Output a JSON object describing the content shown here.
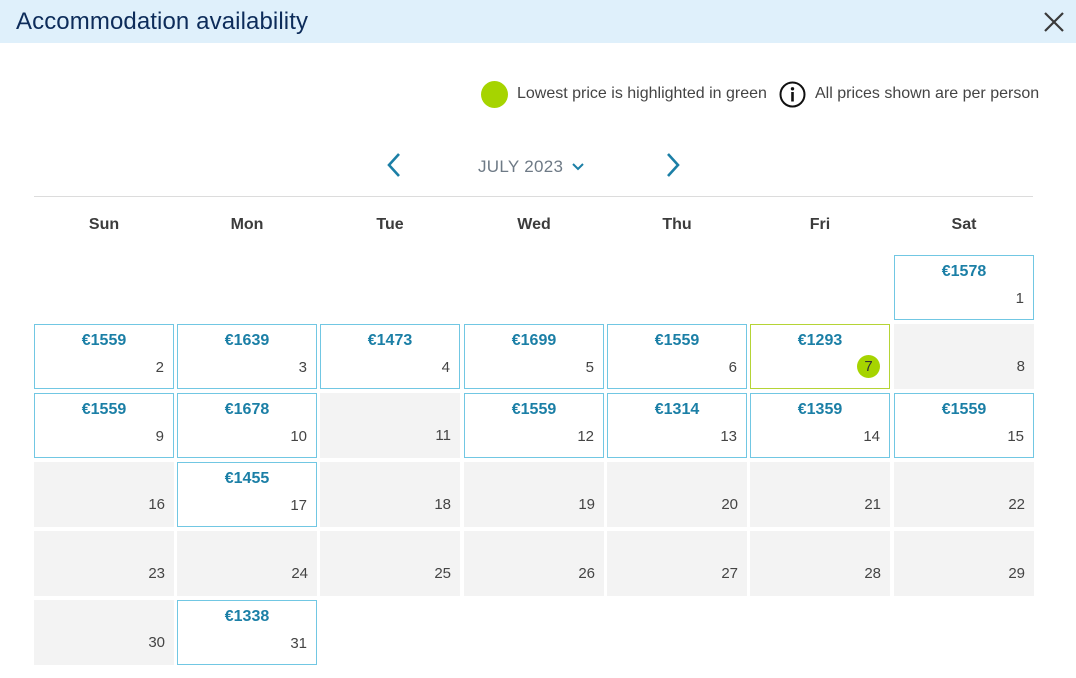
{
  "dialog": {
    "title": "Accommodation availability",
    "close_icon": "close-icon"
  },
  "legend": {
    "lowest_text": "Lowest price is highlighted in green",
    "info_text": "All prices shown are per person",
    "info_icon": "info-icon"
  },
  "colors": {
    "accent_blue": "#1b7fa6",
    "lowest_green": "#a6d400",
    "available_border": "#71c7e3",
    "unavailable_bg": "#f3f3f3",
    "header_bg": "#dff0fb"
  },
  "calendar": {
    "month_label": "JULY 2023",
    "weekdays": [
      "Sun",
      "Mon",
      "Tue",
      "Wed",
      "Thu",
      "Fri",
      "Sat"
    ],
    "days": [
      {
        "day": "1",
        "price": "€1578"
      },
      {
        "day": "2",
        "price": "€1559"
      },
      {
        "day": "3",
        "price": "€1639"
      },
      {
        "day": "4",
        "price": "€1473"
      },
      {
        "day": "5",
        "price": "€1699"
      },
      {
        "day": "6",
        "price": "€1559"
      },
      {
        "day": "7",
        "price": "€1293",
        "lowest": true
      },
      {
        "day": "8",
        "price": ""
      },
      {
        "day": "9",
        "price": "€1559"
      },
      {
        "day": "10",
        "price": "€1678"
      },
      {
        "day": "11",
        "price": ""
      },
      {
        "day": "12",
        "price": "€1559"
      },
      {
        "day": "13",
        "price": "€1314"
      },
      {
        "day": "14",
        "price": "€1359"
      },
      {
        "day": "15",
        "price": "€1559"
      },
      {
        "day": "16",
        "price": ""
      },
      {
        "day": "17",
        "price": "€1455"
      },
      {
        "day": "18",
        "price": ""
      },
      {
        "day": "19",
        "price": ""
      },
      {
        "day": "20",
        "price": ""
      },
      {
        "day": "21",
        "price": ""
      },
      {
        "day": "22",
        "price": ""
      },
      {
        "day": "23",
        "price": ""
      },
      {
        "day": "24",
        "price": ""
      },
      {
        "day": "25",
        "price": ""
      },
      {
        "day": "26",
        "price": ""
      },
      {
        "day": "27",
        "price": ""
      },
      {
        "day": "28",
        "price": ""
      },
      {
        "day": "29",
        "price": ""
      },
      {
        "day": "30",
        "price": ""
      },
      {
        "day": "31",
        "price": "€1338"
      }
    ]
  }
}
